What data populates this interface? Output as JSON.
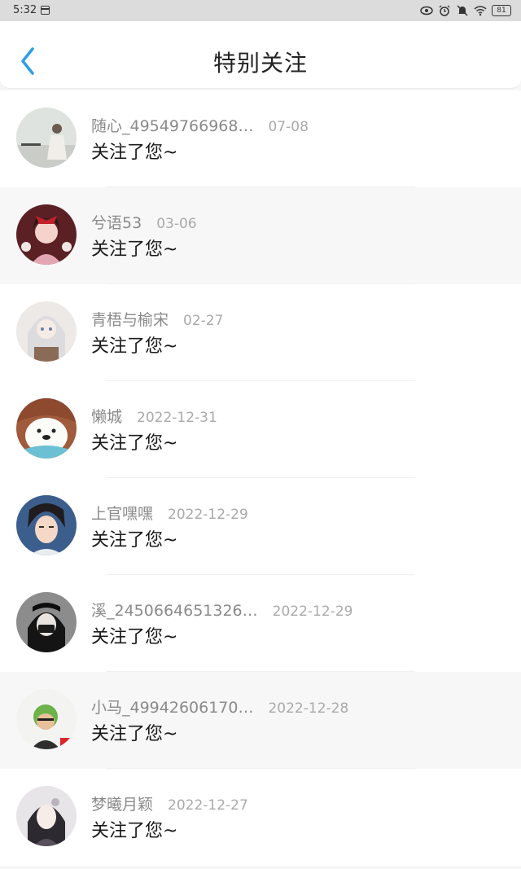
{
  "status_bar": {
    "time": "5:32",
    "battery": "81",
    "icons": [
      "calendar-icon",
      "eye-icon",
      "alarm-icon",
      "mute-icon",
      "wifi-icon",
      "battery-icon"
    ]
  },
  "header": {
    "title": "特别关注",
    "back_icon": "chevron-left-icon",
    "accent_color": "#2b9ee8"
  },
  "items": [
    {
      "name": "随心_49549766968…",
      "date": "07-08",
      "message": "关注了您~"
    },
    {
      "name": "兮语53",
      "date": "03-06",
      "message": "关注了您~"
    },
    {
      "name": "青梧与榆宋",
      "date": "02-27",
      "message": "关注了您~"
    },
    {
      "name": "懒城",
      "date": "2022-12-31",
      "message": "关注了您~"
    },
    {
      "name": "上官嘿嘿",
      "date": "2022-12-29",
      "message": "关注了您~"
    },
    {
      "name": "溪_2450664651326…",
      "date": "2022-12-29",
      "message": "关注了您~"
    },
    {
      "name": "小马_49942606170…",
      "date": "2022-12-28",
      "message": "关注了您~"
    },
    {
      "name": "梦曦月颖",
      "date": "2022-12-27",
      "message": "关注了您~"
    }
  ]
}
